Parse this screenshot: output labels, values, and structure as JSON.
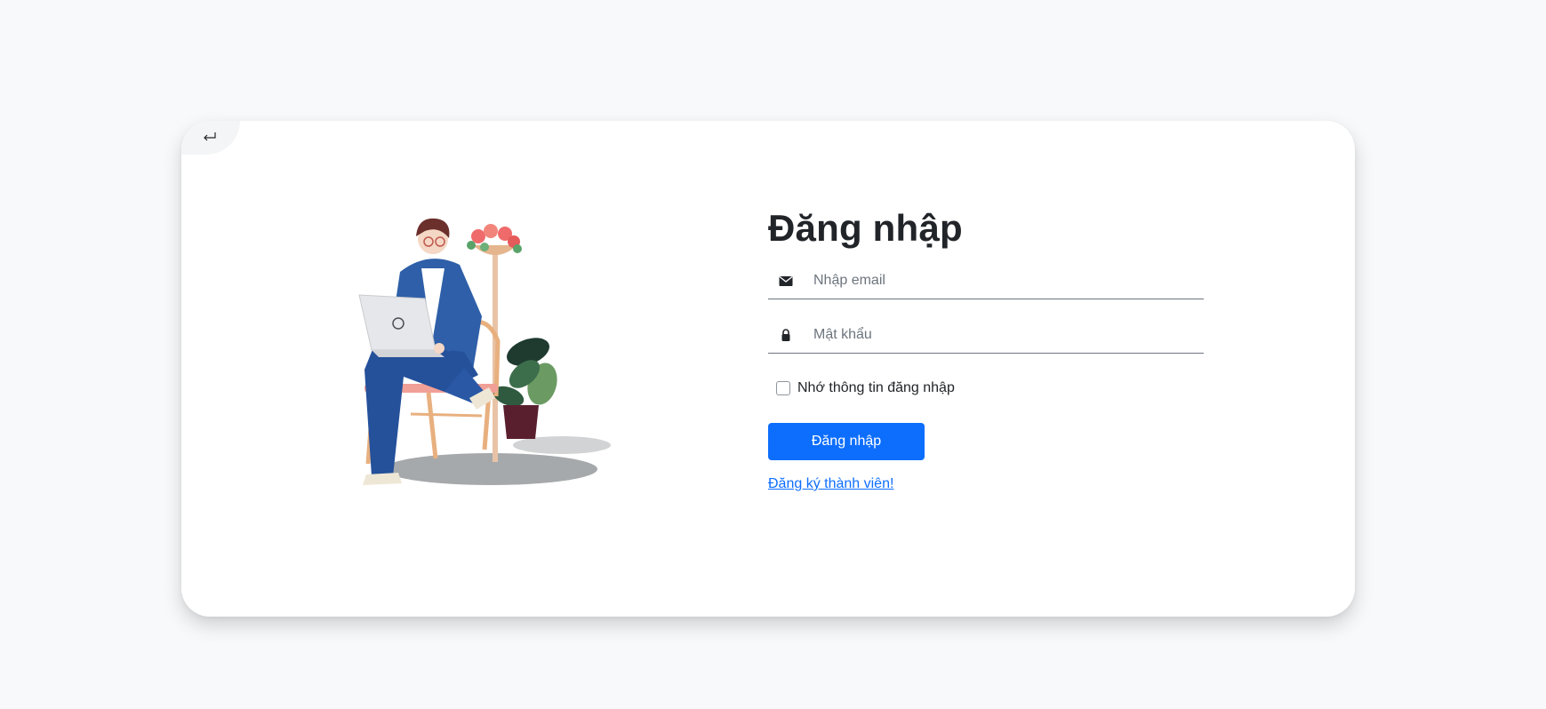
{
  "back_button": {
    "icon": "return-arrow-icon"
  },
  "login_form": {
    "title": "Đăng nhập",
    "email": {
      "icon": "envelope-icon",
      "placeholder": "Nhập email",
      "value": ""
    },
    "password": {
      "icon": "lock-icon",
      "placeholder": "Mật khẩu",
      "value": ""
    },
    "remember_label": "Nhớ thông tin đăng nhập",
    "remember_checked": false,
    "submit_label": "Đăng nhập",
    "register_link": "Đăng ký thành viên!"
  },
  "illustration": {
    "icon": "person-with-laptop-illustration"
  },
  "colors": {
    "primary": "#0d6efd",
    "background": "#f8f9fb",
    "card": "#ffffff",
    "text": "#212529",
    "placeholder": "#6c757d"
  }
}
